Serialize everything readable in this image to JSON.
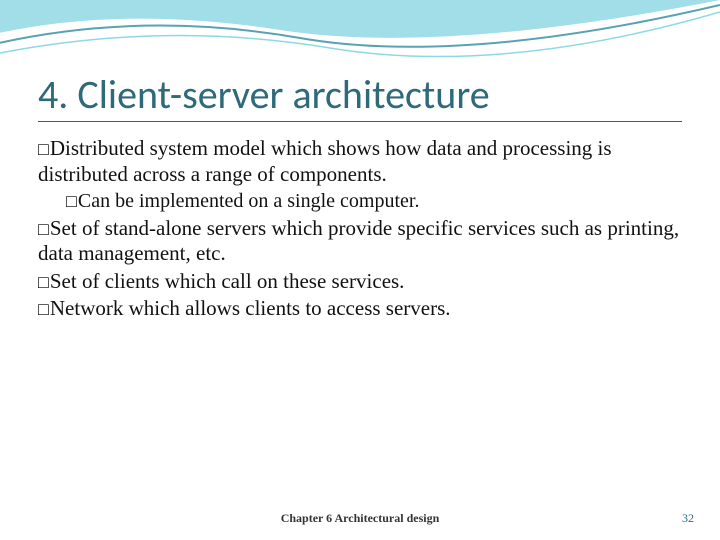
{
  "title": "4. Client-server architecture",
  "bullets": [
    {
      "text": "Distributed system model which shows how data and processing is distributed across a range of components.",
      "sub": "Can be implemented on a single computer."
    },
    {
      "text": "Set of stand-alone servers which provide specific services such as printing, data management, etc."
    },
    {
      "text": "Set of clients which call on these services."
    },
    {
      "text": "Network which allows clients to access servers."
    }
  ],
  "footer": {
    "chapter": "Chapter 6 Architectural design",
    "page": "32"
  }
}
